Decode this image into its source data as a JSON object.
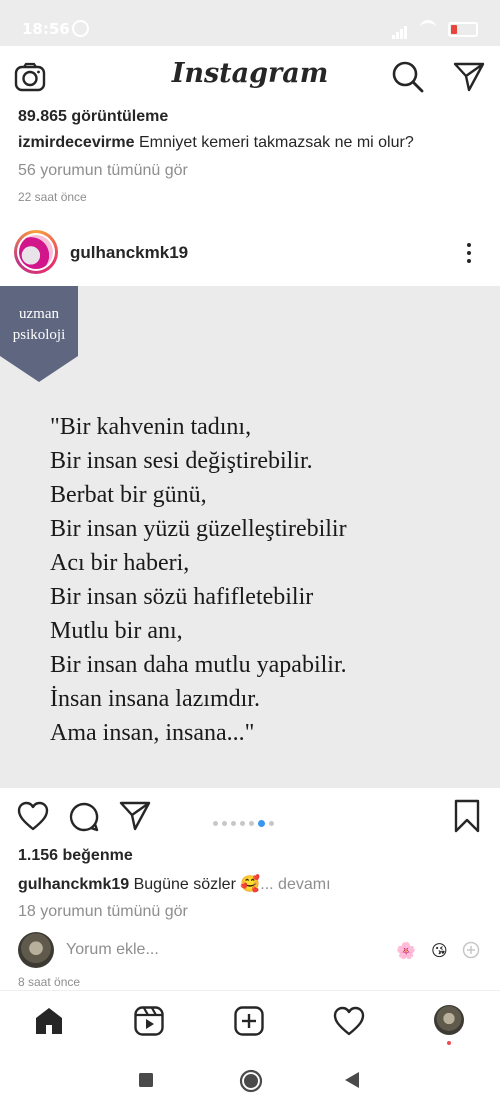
{
  "status": {
    "time": "18:56"
  },
  "header": {
    "logo": "Instagram"
  },
  "prev_post": {
    "views": "89.865 görüntüleme",
    "username": "izmirdecevirme",
    "caption": "Emniyet kemeri takmazsak ne mi olur?",
    "comments": "56 yorumun tümünü gör",
    "time": "22 saat önce"
  },
  "post": {
    "username": "gulhanckmk19",
    "ribbon": [
      "uzman",
      "psikoloji"
    ],
    "poem": [
      "\"Bir kahvenin tadını,",
      "Bir insan sesi değiştirebilir.",
      "Berbat bir günü,",
      "Bir insan yüzü güzelleştirebilir",
      "Acı bir haberi,",
      "Bir insan sözü hafifletebilir",
      "Mutlu bir anı,",
      "Bir insan daha mutlu yapabilir.",
      "İnsan insana lazımdır.",
      "Ama insan, insana...\""
    ],
    "carousel": {
      "count": 7,
      "active": 6
    },
    "likes": "1.156 beğenme",
    "caption": "Bugüne sözler 🥰",
    "more": "... devamı",
    "comments": "18 yorumun tümünü gör",
    "add_comment_placeholder": "Yorum ekle...",
    "quick_emojis": [
      "🌸",
      "😘"
    ],
    "time": "8 saat önce"
  },
  "colors": {
    "ribbon": "#5f6680",
    "carousel_active": "#3897f0",
    "notification": "#ed4956"
  }
}
